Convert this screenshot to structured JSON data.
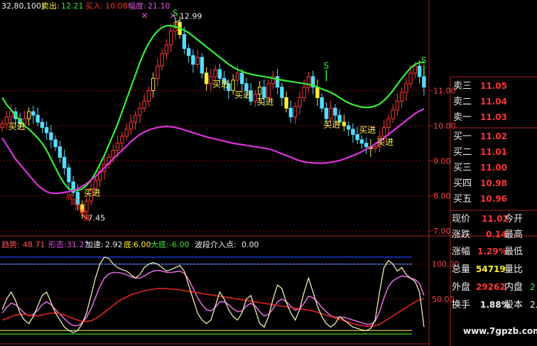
{
  "colors": {
    "background": "#000000",
    "up_candle": "#ff3b3b",
    "down_candle": "#55ddff",
    "highlight_candle": "#ffee33",
    "upper_band": "#33ee33",
    "lower_band": "#dd33dd",
    "grid_red": "#8b0000",
    "panel_border": "#aa2222",
    "buy_label": "#ffee55",
    "sell_signal": "#33ee33",
    "quote_red": "#ff3333",
    "quote_green": "#33ee33",
    "quote_yellow": "#ffee33",
    "white_text": "#eeeeee",
    "osc_white": "#eeeeaa",
    "osc_purple": "#dd66dd",
    "osc_darkred": "#cc2222",
    "osc_blue": "#4466ff",
    "osc_green": "#33dd33"
  },
  "header": {
    "params": "32,80,100)",
    "sell_label": "卖出:",
    "sell_value": "12.21",
    "buy_label": "买入:",
    "buy_value": "10.08",
    "amp_label": "幅度:",
    "amp_value": "21.10",
    "marker": "×"
  },
  "osc_header": {
    "label1": "趋势:",
    "value1": "48.71",
    "label2": "形态:",
    "value2": "31.27",
    "label3": "加速:",
    "value3": "2.92",
    "label4": "底:",
    "value4": "6.00",
    "label5": "大底:",
    "value5": "-6.00",
    "label6": "波段介入点:",
    "value6": "0.00"
  },
  "annotations": {
    "high_marker": "12.99",
    "low_marker": "7.45",
    "signal_s": "S",
    "buy_text": "买进",
    "bottom_text": "底"
  },
  "order_book": {
    "asks": [
      {
        "label": "卖三",
        "price": "11.05"
      },
      {
        "label": "卖二",
        "price": "11.04"
      },
      {
        "label": "卖一",
        "price": "11.03"
      }
    ],
    "bids": [
      {
        "label": "买一",
        "price": "11.02"
      },
      {
        "label": "买二",
        "price": "11.01"
      },
      {
        "label": "买三",
        "price": "11.00"
      },
      {
        "label": "买四",
        "price": "10.98"
      },
      {
        "label": "买五",
        "price": "10.96"
      }
    ]
  },
  "stats": [
    {
      "label": "现价",
      "value": "11.02",
      "label2": "今开",
      "value2": ""
    },
    {
      "label": "涨跌",
      "value": "0.14",
      "label2": "最高",
      "value2": ""
    },
    {
      "label": "涨幅",
      "value": "1.29%",
      "label2": "最低",
      "value2": ""
    },
    {
      "label": "总量",
      "value": "54719",
      "label2": "量比",
      "value2": ""
    },
    {
      "label": "外盘",
      "value": "29262",
      "label2": "内盘",
      "value2": "2"
    },
    {
      "label": "换手",
      "value": "1.88%",
      "label2": "股本",
      "value2": "2."
    }
  ],
  "watermark": "www.7gpzb.com",
  "chart_data": [
    {
      "type": "candlestick",
      "title": "",
      "y_ticks": [
        7.0,
        8.0,
        9.0,
        10.0,
        11.0
      ],
      "ylim": [
        6.9,
        13.3
      ],
      "x_count": 96,
      "close": [
        10.05,
        10.25,
        10.4,
        10.2,
        10.05,
        10.2,
        10.4,
        10.3,
        10.1,
        9.95,
        9.8,
        9.6,
        9.4,
        9.1,
        8.8,
        8.4,
        8.1,
        7.75,
        7.55,
        7.85,
        8.2,
        8.45,
        8.7,
        8.9,
        9.1,
        9.3,
        9.5,
        9.7,
        9.9,
        10.1,
        10.3,
        10.5,
        10.7,
        11.0,
        11.35,
        11.7,
        12.05,
        12.3,
        12.7,
        12.95,
        12.6,
        12.2,
        12.0,
        11.75,
        11.95,
        11.5,
        11.2,
        11.4,
        11.6,
        11.35,
        11.2,
        11.0,
        11.3,
        11.5,
        11.2,
        11.0,
        10.7,
        10.9,
        11.1,
        10.8,
        11.2,
        11.4,
        11.1,
        10.8,
        10.5,
        10.25,
        10.55,
        10.8,
        11.1,
        11.4,
        11.1,
        10.8,
        10.5,
        10.2,
        10.5,
        10.3,
        10.1,
        10.0,
        9.9,
        9.75,
        9.6,
        9.5,
        9.4,
        9.35,
        9.4,
        9.7,
        9.95,
        10.2,
        10.45,
        10.7,
        10.95,
        11.2,
        11.5,
        11.7,
        11.4,
        11.1
      ],
      "upper_band": [
        10.8,
        10.6,
        10.45,
        10.3,
        10.15,
        10.0,
        9.9,
        9.78,
        9.65,
        9.5,
        9.3,
        9.05,
        8.8,
        8.55,
        8.35,
        8.2,
        8.15,
        8.15,
        8.2,
        8.3,
        8.45,
        8.65,
        8.9,
        9.15,
        9.45,
        9.75,
        10.05,
        10.4,
        10.75,
        11.1,
        11.45,
        11.8,
        12.1,
        12.35,
        12.55,
        12.7,
        12.8,
        12.85,
        12.85,
        12.82,
        12.78,
        12.72,
        12.65,
        12.55,
        12.45,
        12.35,
        12.25,
        12.15,
        12.05,
        11.95,
        11.85,
        11.75,
        11.67,
        11.6,
        11.55,
        11.5,
        11.47,
        11.44,
        11.42,
        11.4,
        11.38,
        11.35,
        11.32,
        11.3,
        11.28,
        11.26,
        11.24,
        11.22,
        11.2,
        11.18,
        11.15,
        11.1,
        11.05,
        11.0,
        10.95,
        10.88,
        10.8,
        10.72,
        10.65,
        10.6,
        10.56,
        10.53,
        10.52,
        10.53,
        10.56,
        10.62,
        10.72,
        10.85,
        11.0,
        11.18,
        11.35,
        11.5,
        11.65,
        11.75,
        11.8,
        11.82
      ],
      "lower_band": [
        9.65,
        9.45,
        9.25,
        9.05,
        8.9,
        8.75,
        8.6,
        8.45,
        8.3,
        8.2,
        8.12,
        8.08,
        8.07,
        8.08,
        8.1,
        8.12,
        8.15,
        8.2,
        8.27,
        8.35,
        8.45,
        8.55,
        8.67,
        8.8,
        8.93,
        9.05,
        9.18,
        9.3,
        9.42,
        9.55,
        9.65,
        9.75,
        9.82,
        9.88,
        9.92,
        9.95,
        9.97,
        9.98,
        9.97,
        9.95,
        9.92,
        9.88,
        9.84,
        9.8,
        9.76,
        9.72,
        9.68,
        9.65,
        9.62,
        9.59,
        9.56,
        9.53,
        9.5,
        9.48,
        9.46,
        9.44,
        9.42,
        9.4,
        9.38,
        9.36,
        9.34,
        9.3,
        9.25,
        9.2,
        9.15,
        9.1,
        9.05,
        9.0,
        8.97,
        8.95,
        8.94,
        8.93,
        8.93,
        8.94,
        8.96,
        8.98,
        9.01,
        9.05,
        9.1,
        9.15,
        9.2,
        9.26,
        9.33,
        9.4,
        9.48,
        9.56,
        9.65,
        9.75,
        9.85,
        9.95,
        10.05,
        10.15,
        10.25,
        10.35,
        10.42,
        10.48
      ]
    },
    {
      "type": "line",
      "title": "",
      "y_ticks": [
        50.0,
        100.0
      ],
      "ylim": [
        -10,
        120
      ],
      "hlines": [
        110,
        100,
        0,
        5
      ],
      "x_count": 96,
      "series": [
        {
          "name": "趋势",
          "values": [
            35,
            50,
            60,
            48,
            30,
            20,
            15,
            25,
            40,
            55,
            60,
            45,
            30,
            20,
            10,
            5,
            2,
            5,
            15,
            30,
            55,
            80,
            100,
            110,
            108,
            100,
            95,
            92,
            90,
            85,
            80,
            85,
            95,
            100,
            102,
            100,
            95,
            90,
            92,
            95,
            98,
            90,
            70,
            50,
            30,
            20,
            15,
            20,
            40,
            60,
            50,
            35,
            25,
            20,
            30,
            50,
            55,
            35,
            15,
            10,
            25,
            50,
            70,
            65,
            45,
            30,
            20,
            35,
            60,
            80,
            60,
            40,
            25,
            15,
            10,
            15,
            25,
            20,
            15,
            10,
            8,
            6,
            5,
            8,
            20,
            60,
            95,
            105,
            100,
            90,
            95,
            85,
            80,
            75,
            60,
            10
          ]
        },
        {
          "name": "形态",
          "values": [
            30,
            38,
            44,
            42,
            36,
            30,
            26,
            28,
            34,
            42,
            46,
            42,
            35,
            28,
            22,
            16,
            12,
            12,
            16,
            24,
            36,
            52,
            68,
            80,
            86,
            88,
            88,
            87,
            85,
            82,
            80,
            80,
            83,
            87,
            90,
            91,
            90,
            88,
            88,
            89,
            90,
            87,
            78,
            65,
            52,
            42,
            35,
            33,
            38,
            46,
            46,
            42,
            36,
            32,
            33,
            40,
            44,
            40,
            32,
            26,
            28,
            36,
            46,
            50,
            46,
            40,
            34,
            36,
            44,
            54,
            52,
            46,
            38,
            32,
            26,
            24,
            24,
            24,
            22,
            20,
            18,
            16,
            14,
            14,
            18,
            32,
            52,
            68,
            76,
            80,
            83,
            82,
            80,
            78,
            72,
            55
          ]
        },
        {
          "name": "加速",
          "values": [
            20,
            22,
            25,
            27,
            28,
            28,
            27,
            26,
            26,
            27,
            29,
            30,
            30,
            29,
            27,
            25,
            22,
            20,
            18,
            18,
            19,
            22,
            26,
            31,
            36,
            41,
            46,
            50,
            53,
            56,
            58,
            60,
            62,
            63,
            64,
            65,
            65,
            65,
            64,
            64,
            63,
            62,
            61,
            60,
            59,
            58,
            57,
            56,
            55,
            54,
            53,
            52,
            51,
            50,
            49,
            48,
            47,
            46,
            45,
            44,
            43,
            42,
            41,
            40,
            39,
            38,
            37,
            36,
            35,
            34,
            33,
            31,
            29,
            27,
            25,
            23,
            21,
            19,
            17,
            15,
            13,
            12,
            11,
            11,
            12,
            14,
            18,
            22,
            26,
            30,
            34,
            38,
            42,
            46,
            49,
            51
          ]
        }
      ]
    }
  ]
}
